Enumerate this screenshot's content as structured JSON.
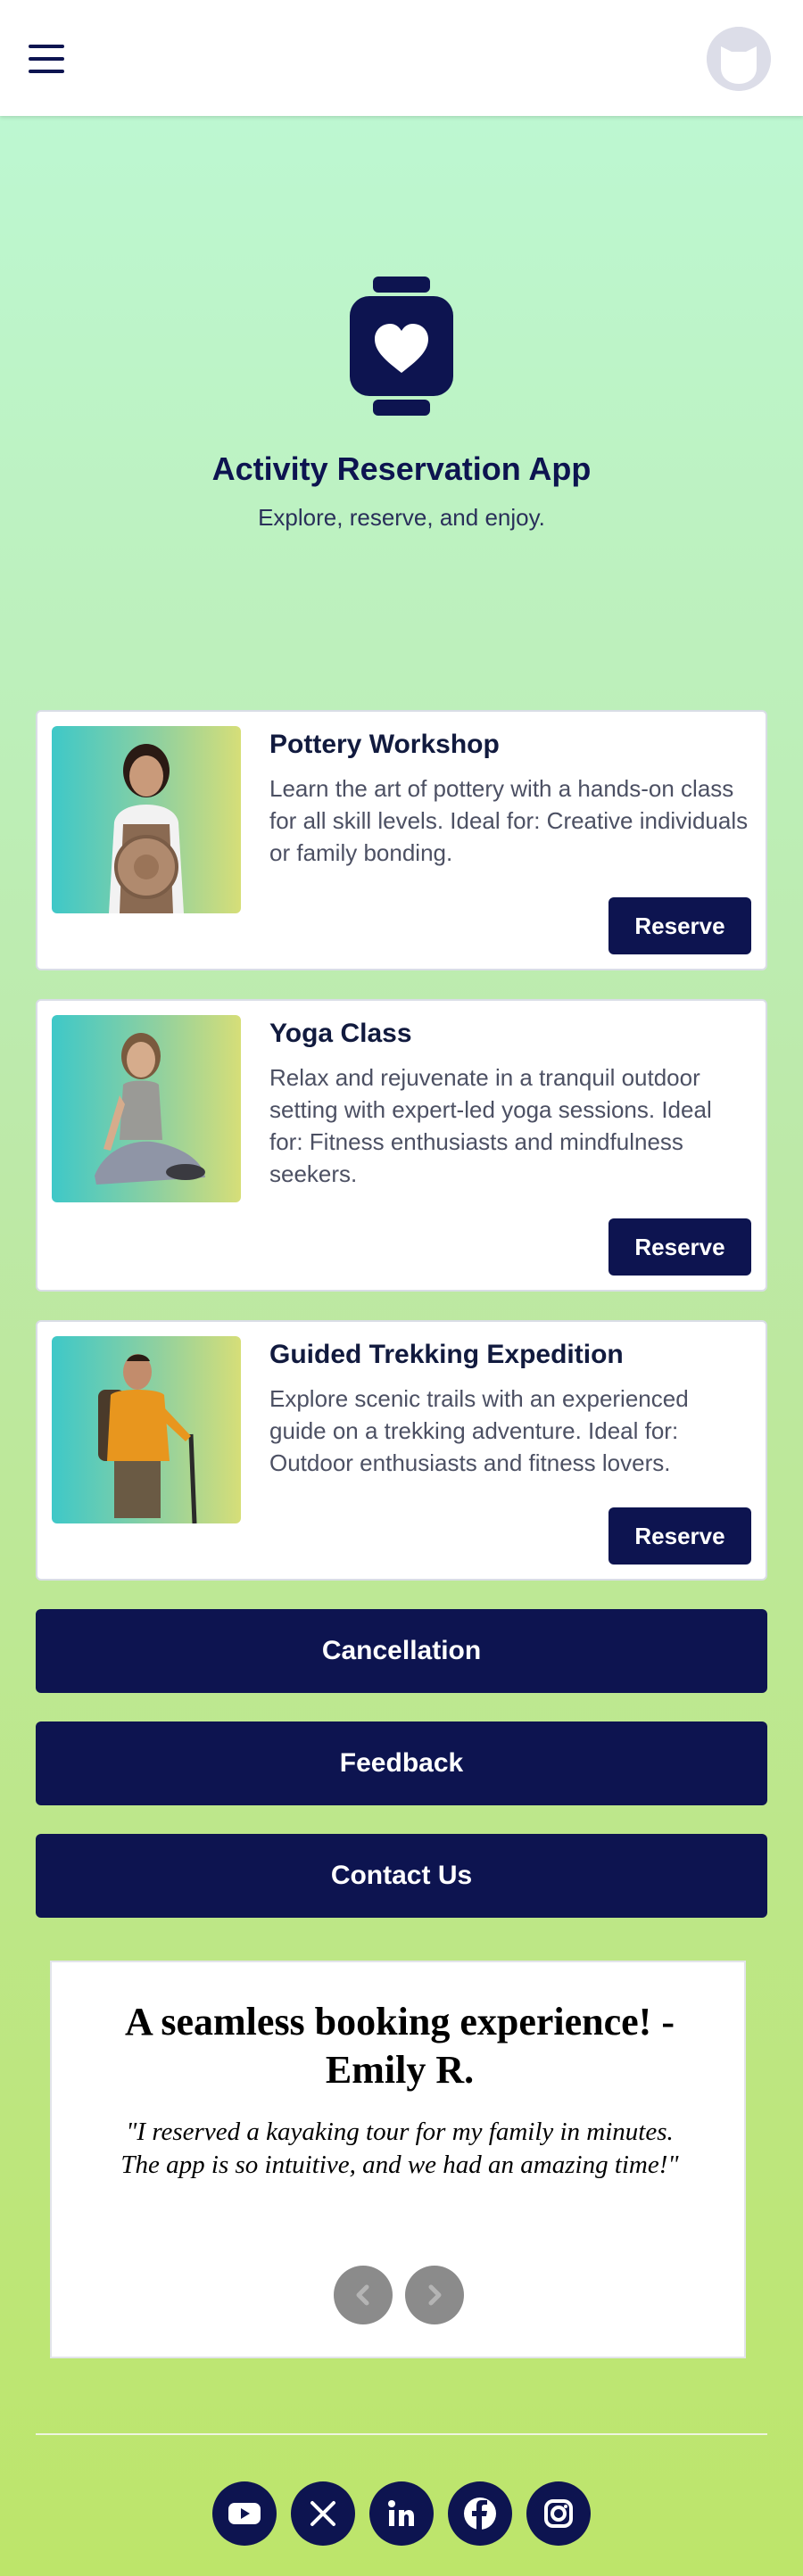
{
  "app": {
    "title": "Activity Reservation App",
    "tagline": "Explore, reserve, and enjoy."
  },
  "colors": {
    "primary": "#0d1450",
    "bg_top": "#bdf9d6",
    "bg_bottom": "#bde56a",
    "card_bg": "#ffffff"
  },
  "icons": {
    "menu": "hamburger-menu-icon",
    "profile": "user-avatar-icon",
    "hero": "smartwatch-heart-icon"
  },
  "activities": [
    {
      "title": "Pottery Workshop",
      "description": "Learn the art of pottery with a hands-on class for all skill levels. Ideal for: Creative individuals or family bonding.",
      "button": "Reserve"
    },
    {
      "title": "Yoga Class",
      "description": "Relax and rejuvenate in a tranquil outdoor setting with expert-led yoga sessions. Ideal for: Fitness enthusiasts and mindfulness seekers.",
      "button": "Reserve"
    },
    {
      "title": "Guided Trekking Expedition",
      "description": "Explore scenic trails with an experienced guide on a trekking adventure. Ideal for: Outdoor enthusiasts and fitness lovers.",
      "button": "Reserve"
    }
  ],
  "actions": {
    "cancellation": "Cancellation",
    "feedback": "Feedback",
    "contact": "Contact Us"
  },
  "testimonial": {
    "headline": "A seamless booking experience! - Emily R.",
    "quote": "\"I reserved a kayaking tour for my family in minutes. The app is so intuitive, and we had an amazing time!\""
  },
  "social": [
    "youtube-icon",
    "x-icon",
    "linkedin-icon",
    "facebook-icon",
    "instagram-icon"
  ]
}
